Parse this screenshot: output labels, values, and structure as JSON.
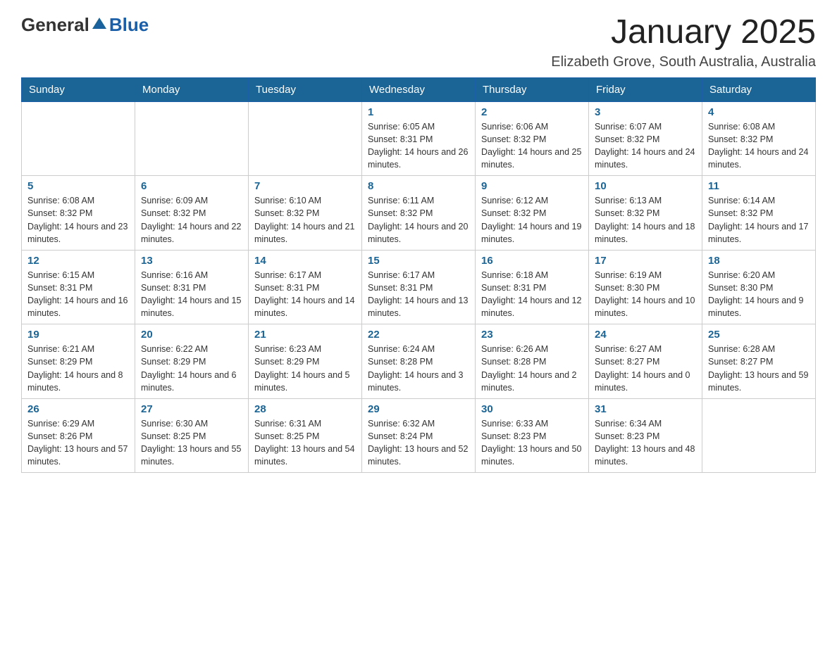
{
  "logo": {
    "general": "General",
    "blue": "Blue"
  },
  "title": "January 2025",
  "location": "Elizabeth Grove, South Australia, Australia",
  "days_of_week": [
    "Sunday",
    "Monday",
    "Tuesday",
    "Wednesday",
    "Thursday",
    "Friday",
    "Saturday"
  ],
  "weeks": [
    [
      {
        "day": "",
        "info": ""
      },
      {
        "day": "",
        "info": ""
      },
      {
        "day": "",
        "info": ""
      },
      {
        "day": "1",
        "info": "Sunrise: 6:05 AM\nSunset: 8:31 PM\nDaylight: 14 hours and 26 minutes."
      },
      {
        "day": "2",
        "info": "Sunrise: 6:06 AM\nSunset: 8:32 PM\nDaylight: 14 hours and 25 minutes."
      },
      {
        "day": "3",
        "info": "Sunrise: 6:07 AM\nSunset: 8:32 PM\nDaylight: 14 hours and 24 minutes."
      },
      {
        "day": "4",
        "info": "Sunrise: 6:08 AM\nSunset: 8:32 PM\nDaylight: 14 hours and 24 minutes."
      }
    ],
    [
      {
        "day": "5",
        "info": "Sunrise: 6:08 AM\nSunset: 8:32 PM\nDaylight: 14 hours and 23 minutes."
      },
      {
        "day": "6",
        "info": "Sunrise: 6:09 AM\nSunset: 8:32 PM\nDaylight: 14 hours and 22 minutes."
      },
      {
        "day": "7",
        "info": "Sunrise: 6:10 AM\nSunset: 8:32 PM\nDaylight: 14 hours and 21 minutes."
      },
      {
        "day": "8",
        "info": "Sunrise: 6:11 AM\nSunset: 8:32 PM\nDaylight: 14 hours and 20 minutes."
      },
      {
        "day": "9",
        "info": "Sunrise: 6:12 AM\nSunset: 8:32 PM\nDaylight: 14 hours and 19 minutes."
      },
      {
        "day": "10",
        "info": "Sunrise: 6:13 AM\nSunset: 8:32 PM\nDaylight: 14 hours and 18 minutes."
      },
      {
        "day": "11",
        "info": "Sunrise: 6:14 AM\nSunset: 8:32 PM\nDaylight: 14 hours and 17 minutes."
      }
    ],
    [
      {
        "day": "12",
        "info": "Sunrise: 6:15 AM\nSunset: 8:31 PM\nDaylight: 14 hours and 16 minutes."
      },
      {
        "day": "13",
        "info": "Sunrise: 6:16 AM\nSunset: 8:31 PM\nDaylight: 14 hours and 15 minutes."
      },
      {
        "day": "14",
        "info": "Sunrise: 6:17 AM\nSunset: 8:31 PM\nDaylight: 14 hours and 14 minutes."
      },
      {
        "day": "15",
        "info": "Sunrise: 6:17 AM\nSunset: 8:31 PM\nDaylight: 14 hours and 13 minutes."
      },
      {
        "day": "16",
        "info": "Sunrise: 6:18 AM\nSunset: 8:31 PM\nDaylight: 14 hours and 12 minutes."
      },
      {
        "day": "17",
        "info": "Sunrise: 6:19 AM\nSunset: 8:30 PM\nDaylight: 14 hours and 10 minutes."
      },
      {
        "day": "18",
        "info": "Sunrise: 6:20 AM\nSunset: 8:30 PM\nDaylight: 14 hours and 9 minutes."
      }
    ],
    [
      {
        "day": "19",
        "info": "Sunrise: 6:21 AM\nSunset: 8:29 PM\nDaylight: 14 hours and 8 minutes."
      },
      {
        "day": "20",
        "info": "Sunrise: 6:22 AM\nSunset: 8:29 PM\nDaylight: 14 hours and 6 minutes."
      },
      {
        "day": "21",
        "info": "Sunrise: 6:23 AM\nSunset: 8:29 PM\nDaylight: 14 hours and 5 minutes."
      },
      {
        "day": "22",
        "info": "Sunrise: 6:24 AM\nSunset: 8:28 PM\nDaylight: 14 hours and 3 minutes."
      },
      {
        "day": "23",
        "info": "Sunrise: 6:26 AM\nSunset: 8:28 PM\nDaylight: 14 hours and 2 minutes."
      },
      {
        "day": "24",
        "info": "Sunrise: 6:27 AM\nSunset: 8:27 PM\nDaylight: 14 hours and 0 minutes."
      },
      {
        "day": "25",
        "info": "Sunrise: 6:28 AM\nSunset: 8:27 PM\nDaylight: 13 hours and 59 minutes."
      }
    ],
    [
      {
        "day": "26",
        "info": "Sunrise: 6:29 AM\nSunset: 8:26 PM\nDaylight: 13 hours and 57 minutes."
      },
      {
        "day": "27",
        "info": "Sunrise: 6:30 AM\nSunset: 8:25 PM\nDaylight: 13 hours and 55 minutes."
      },
      {
        "day": "28",
        "info": "Sunrise: 6:31 AM\nSunset: 8:25 PM\nDaylight: 13 hours and 54 minutes."
      },
      {
        "day": "29",
        "info": "Sunrise: 6:32 AM\nSunset: 8:24 PM\nDaylight: 13 hours and 52 minutes."
      },
      {
        "day": "30",
        "info": "Sunrise: 6:33 AM\nSunset: 8:23 PM\nDaylight: 13 hours and 50 minutes."
      },
      {
        "day": "31",
        "info": "Sunrise: 6:34 AM\nSunset: 8:23 PM\nDaylight: 13 hours and 48 minutes."
      },
      {
        "day": "",
        "info": ""
      }
    ]
  ]
}
